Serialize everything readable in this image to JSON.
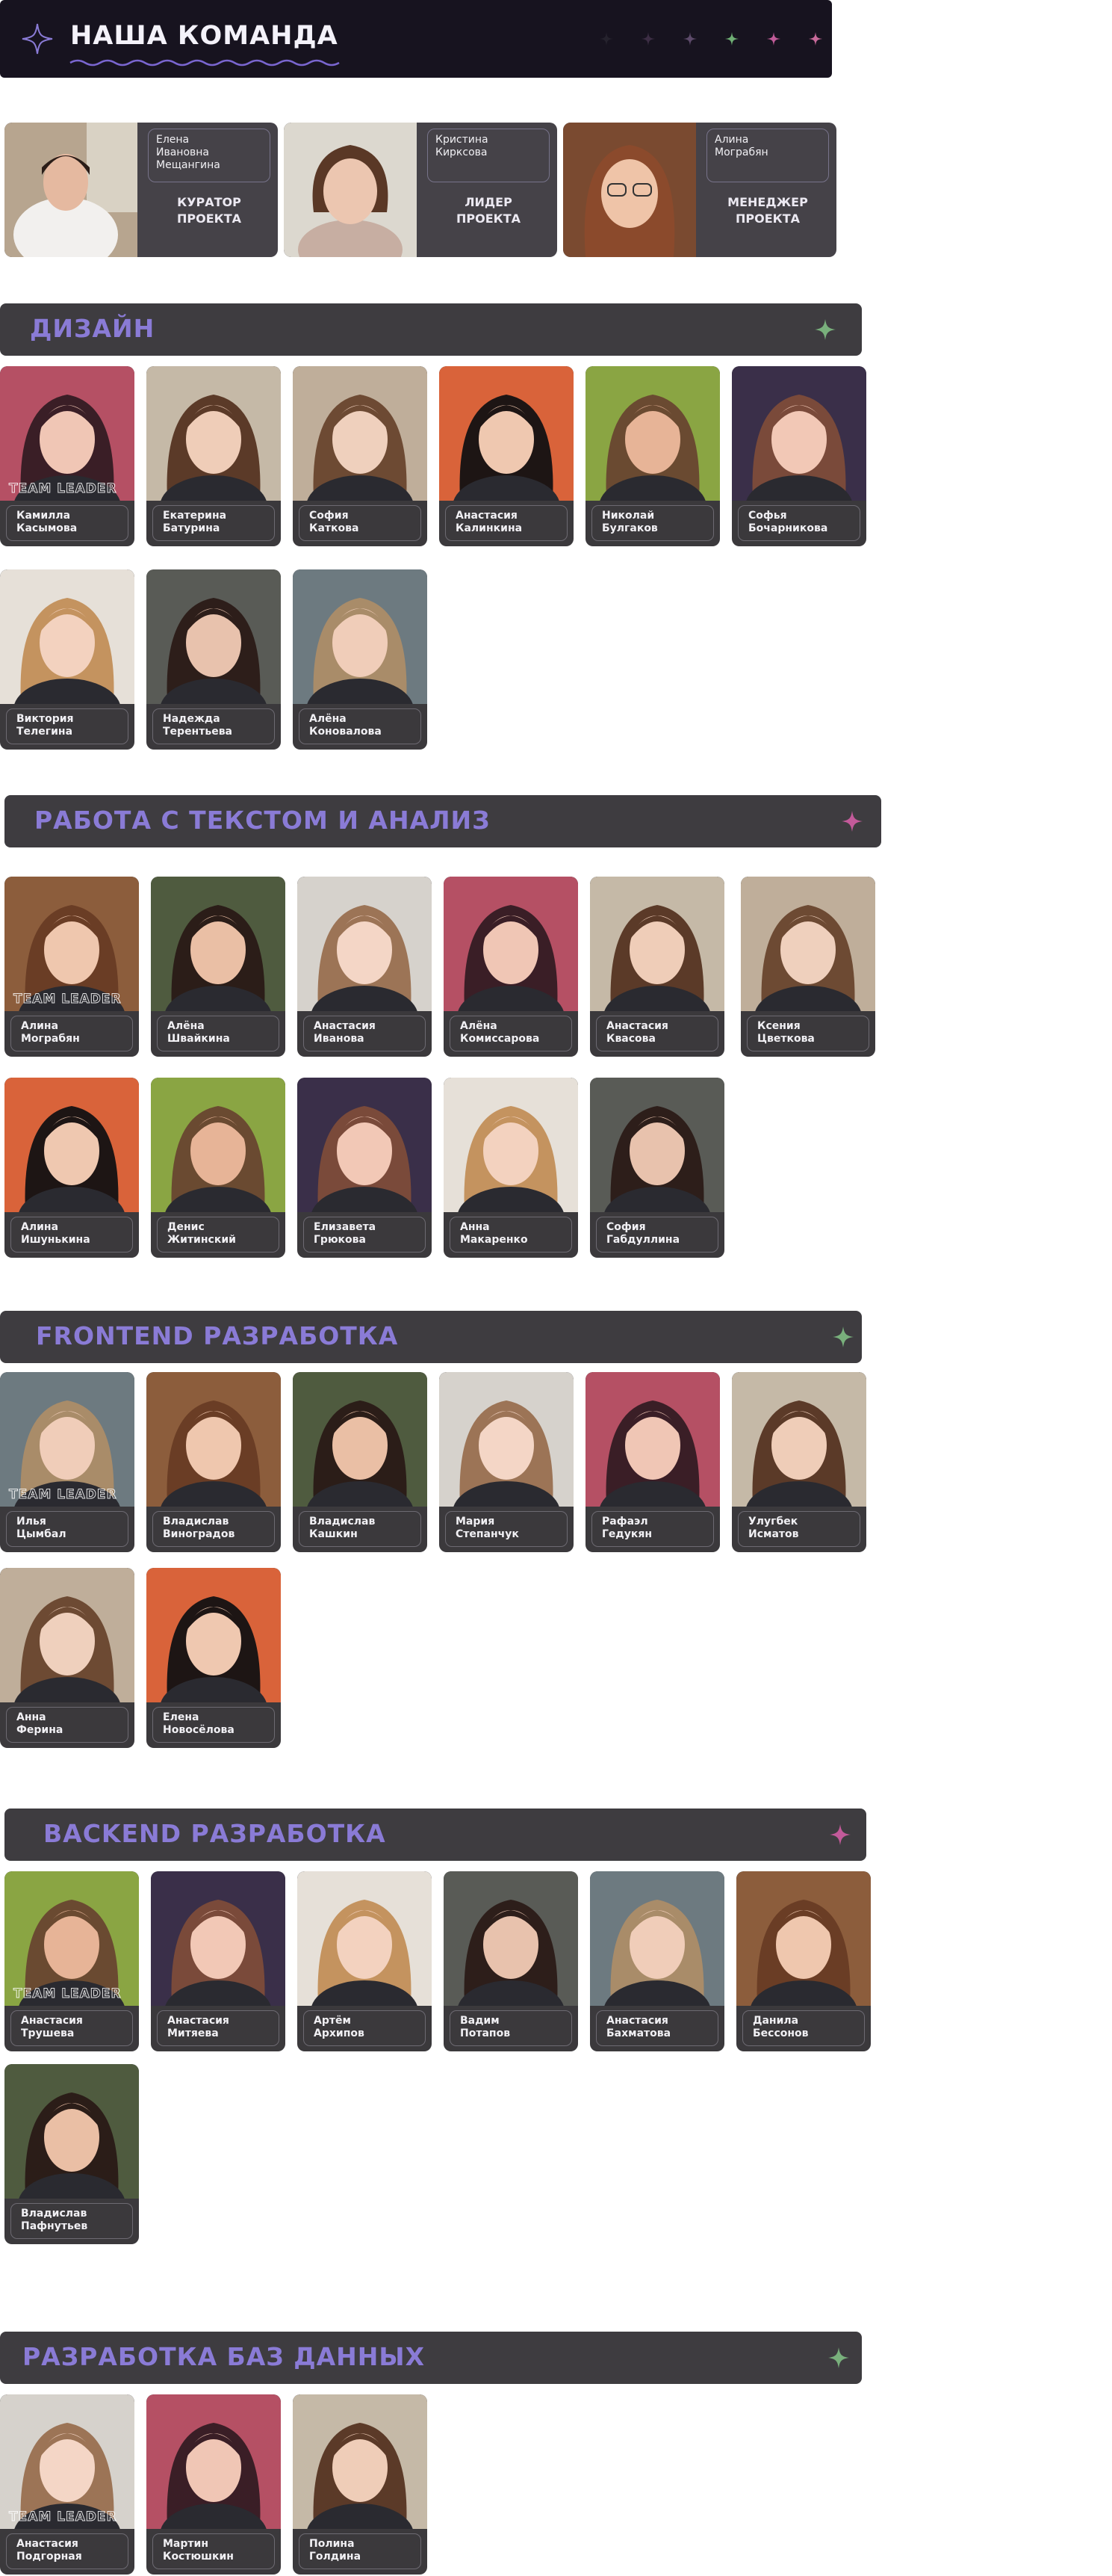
{
  "page": {
    "title": "НАША КОМАНДА"
  },
  "team_leader_label": "TEAM LEADER",
  "colors": {
    "accent": "#8a7bd6",
    "pink": "#c35a9a",
    "green": "#79b07c",
    "card": "#3b393c"
  },
  "leads": [
    {
      "name": "Елена\nИвановна\nМещангина",
      "role": "КУРАТОР\nПРОЕКТА"
    },
    {
      "name": "Кристина\nКирксова",
      "role": "ЛИДЕР\nПРОЕКТА"
    },
    {
      "name": "Алина\nМограбян",
      "role": "МЕНЕДЖЕР\nПРОЕКТА"
    }
  ],
  "sections": [
    {
      "title": "ДИЗАЙН",
      "star": "green-star-icon",
      "members": [
        {
          "name": "Камилла\nКасымова",
          "leader": true
        },
        {
          "name": "Екатерина\nБатурина"
        },
        {
          "name": "София\nКаткова"
        },
        {
          "name": "Анастасия\nКалинкина"
        },
        {
          "name": "Николай\nБулгаков"
        },
        {
          "name": "Софья\nБочарникова"
        },
        {
          "name": "Виктория\nТелегина"
        },
        {
          "name": "Надежда\nТерентьева"
        },
        {
          "name": "Алёна\nКоновалова"
        }
      ]
    },
    {
      "title": "РАБОТА С ТЕКСТОМ И АНАЛИЗ",
      "star": "pink-star-icon",
      "members": [
        {
          "name": "Алина\nМограбян",
          "leader": true
        },
        {
          "name": "Алёна\nШвайкина"
        },
        {
          "name": "Анастасия\nИванова"
        },
        {
          "name": "Алёна\nКомиссарова"
        },
        {
          "name": "Анастасия\nКвасова"
        },
        {
          "name": "Ксения\nЦветкова"
        },
        {
          "name": "Алина\nИшунькина"
        },
        {
          "name": "Денис\nЖитинский"
        },
        {
          "name": "Елизавета\nГрюкова"
        },
        {
          "name": "Анна\nМакаренко"
        },
        {
          "name": "София\nГабдуллина"
        }
      ]
    },
    {
      "title": "FRONTEND РАЗРАБОТКА",
      "star": "green-star-icon",
      "members": [
        {
          "name": "Илья\nЦымбал",
          "leader": true
        },
        {
          "name": "Владислав\nВиноградов"
        },
        {
          "name": "Владислав\nКашкин"
        },
        {
          "name": "Мария\nСтепанчук"
        },
        {
          "name": "Рафаэл\nГедукян"
        },
        {
          "name": "Улугбек\nИсматов"
        },
        {
          "name": "Анна\nФерина"
        },
        {
          "name": "Елена\nНовосёлова"
        }
      ]
    },
    {
      "title": "BACKEND РАЗРАБОТКА",
      "star": "pink-star-icon",
      "members": [
        {
          "name": "Анастасия\nТрушева",
          "leader": true
        },
        {
          "name": "Анастасия\nМитяева"
        },
        {
          "name": "Артём\nАрхипов"
        },
        {
          "name": "Вадим\nПотапов"
        },
        {
          "name": "Анастасия\nБахматова"
        },
        {
          "name": "Данила\nБессонов"
        },
        {
          "name": "Владислав\nПафнутьев"
        }
      ]
    },
    {
      "title": "РАЗРАБОТКА БАЗ ДАННЫХ",
      "star": "green-star-icon",
      "members": [
        {
          "name": "Анастасия\nПодгорная",
          "leader": true
        },
        {
          "name": "Мартин\nКостюшкин"
        },
        {
          "name": "Полина\nГолдина"
        }
      ]
    }
  ]
}
